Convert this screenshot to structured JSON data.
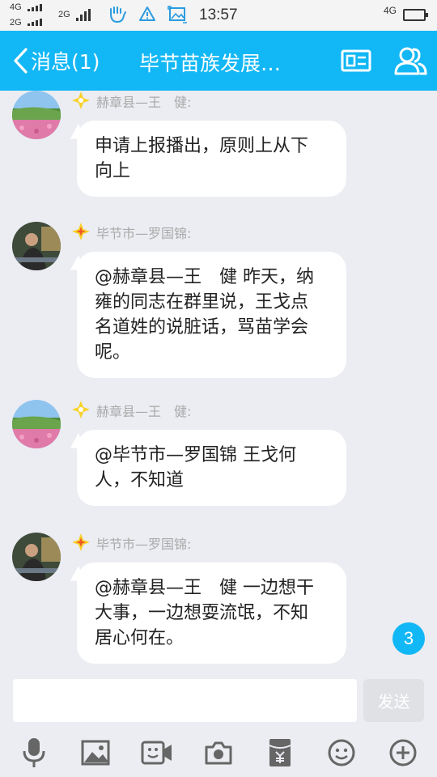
{
  "status_bar": {
    "network_top": "4G",
    "network_bottom": "2G",
    "network_mid": "2G",
    "network_right": "4G",
    "time": "13:57"
  },
  "header": {
    "back_label": "消息(1)",
    "title": "毕节苗族发展…"
  },
  "messages": [
    {
      "sender": "赫章县—王　健:",
      "lines": [
        "申请上报播出，原则上从下",
        "向上"
      ]
    },
    {
      "sender": "毕节市—罗国锦:",
      "lines": [
        "@赫章县—王　健 昨天，纳",
        "雍的同志在群里说，王戈点",
        "名道姓的说脏话，骂苗学会",
        "呢。"
      ]
    },
    {
      "sender": "赫章县—王　健:",
      "lines": [
        "@毕节市—罗国锦 王戈何",
        "人，不知道"
      ]
    },
    {
      "sender": "毕节市—罗国锦:",
      "lines": [
        "@赫章县—王　健 一边想干",
        "大事，一边想耍流氓，不知",
        "居心何在。"
      ]
    }
  ],
  "unread_badge": "3",
  "composer": {
    "placeholder": "",
    "send_label": "发送"
  },
  "toolbar_icons": [
    "microphone-icon",
    "image-icon",
    "video-icon",
    "camera-icon",
    "red-packet-icon",
    "emoji-icon",
    "plus-icon"
  ],
  "colors": {
    "accent": "#12b7f5",
    "background": "#ebedf2",
    "sender_text": "#a9a9a9"
  }
}
